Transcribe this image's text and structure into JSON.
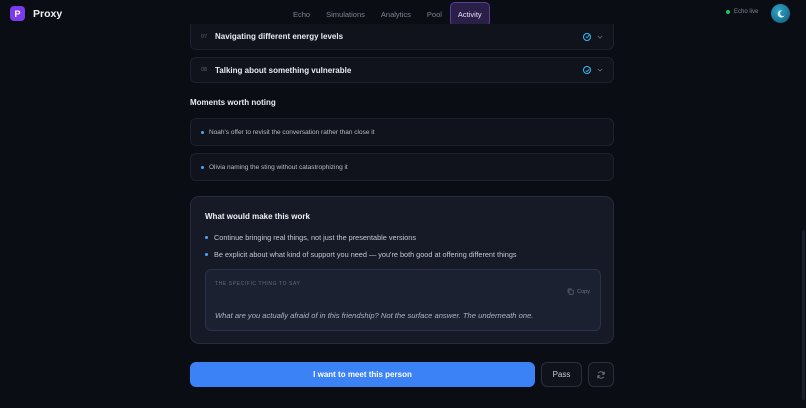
{
  "app": {
    "logo_letter": "P",
    "name": "Proxy"
  },
  "nav": {
    "items": [
      {
        "label": "Echo"
      },
      {
        "label": "Simulations"
      },
      {
        "label": "Analytics"
      },
      {
        "label": "Pool"
      },
      {
        "label": "Activity",
        "active": true
      }
    ]
  },
  "status": {
    "label": "Echo live",
    "color": "#22c55e"
  },
  "steps": [
    {
      "num": "07",
      "title": "Navigating different energy levels"
    },
    {
      "num": "08",
      "title": "Talking about something vulnerable"
    }
  ],
  "moments": {
    "title": "Moments worth noting",
    "items": [
      "Noah's offer to revisit the conversation rather than close it",
      "Olivia naming the sting without catastrophizing it"
    ]
  },
  "advice": {
    "title": "What would make this work",
    "items": [
      "Continue bringing real things, not just the presentable versions",
      "Be explicit about what kind of support you need — you're both good at offering different things"
    ],
    "quote_label": "THE SPECIFIC THING TO SAY",
    "copy_label": "Copy",
    "quote": "What are you actually afraid of in this friendship? Not the surface answer. The underneath one."
  },
  "actions": {
    "primary": "I want to meet this person",
    "secondary": "Pass"
  },
  "colors": {
    "accent": "#3b82f6",
    "brand": "#7c3aed"
  },
  "icons": [
    "check-circle-icon",
    "chevron-down-icon",
    "copy-icon",
    "refresh-icon",
    "moon-icon"
  ]
}
